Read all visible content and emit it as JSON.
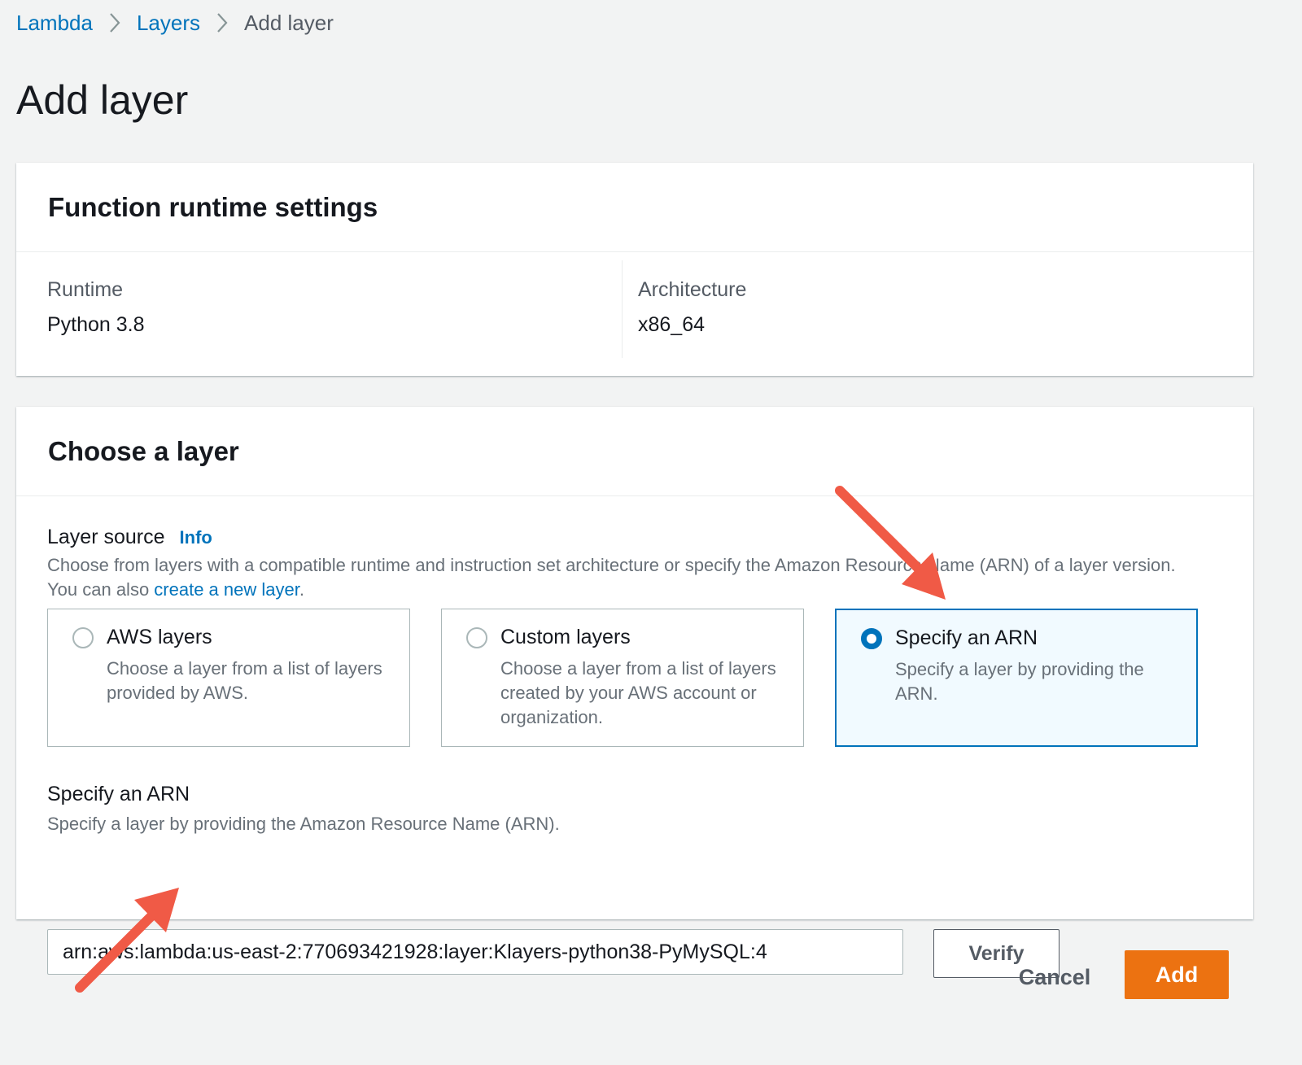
{
  "breadcrumb": {
    "items": [
      {
        "label": "Lambda"
      },
      {
        "label": "Layers"
      },
      {
        "label": "Add layer"
      }
    ]
  },
  "page": {
    "title": "Add layer"
  },
  "runtime_settings": {
    "header": "Function runtime settings",
    "runtime_label": "Runtime",
    "runtime_value": "Python 3.8",
    "architecture_label": "Architecture",
    "architecture_value": "x86_64"
  },
  "choose_layer": {
    "header": "Choose a layer",
    "layer_source_label": "Layer source",
    "info_link": "Info",
    "description_text": "Choose from layers with a compatible runtime and instruction set architecture or specify the Amazon Resource Name (ARN) of a layer version. You can also ",
    "description_link": "create a new layer",
    "description_end": ".",
    "options": [
      {
        "title": "AWS layers",
        "description": "Choose a layer from a list of layers provided by AWS.",
        "selected": false
      },
      {
        "title": "Custom layers",
        "description": "Choose a layer from a list of layers created by your AWS account or organization.",
        "selected": false
      },
      {
        "title": "Specify an ARN",
        "description": "Specify a layer by providing the ARN.",
        "selected": true
      }
    ],
    "arn_label": "Specify an ARN",
    "arn_description": "Specify a layer by providing the Amazon Resource Name (ARN).",
    "arn_value": "arn:aws:lambda:us-east-2:770693421928:layer:Klayers-python38-PyMySQL:4",
    "verify_label": "Verify"
  },
  "footer": {
    "cancel_label": "Cancel",
    "add_label": "Add"
  },
  "colors": {
    "accent": "#0073bb",
    "primary_button": "#ec7211",
    "annotation_arrow": "#f05a46"
  },
  "icons": {
    "breadcrumb_separator": "chevron-right-icon"
  }
}
